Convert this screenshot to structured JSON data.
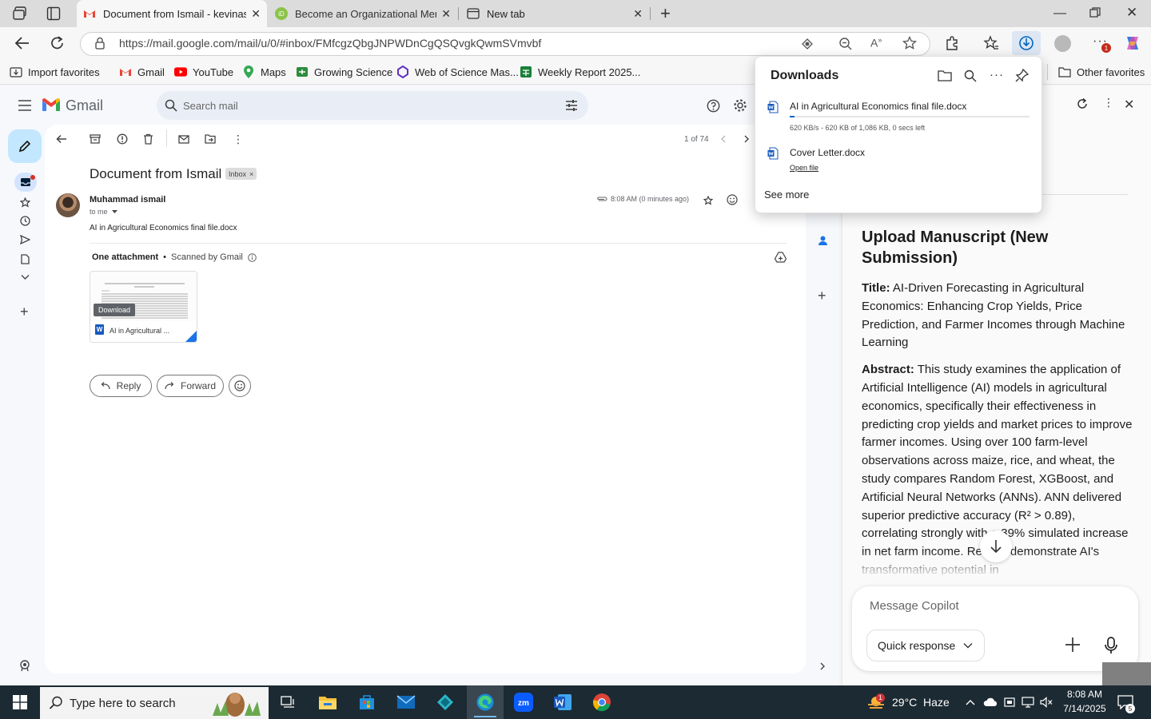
{
  "browser": {
    "tabs": [
      {
        "title": "Document from Ismail - kevinasut",
        "active": true
      },
      {
        "title": "Become an Organizational Memb",
        "active": false
      },
      {
        "title": "New tab",
        "active": false
      }
    ],
    "url": "https://mail.google.com/mail/u/0/#inbox/FMfcgzQbgJNPWDnCgQSQvgkQwmSVmvbf",
    "favorites": [
      "Import favorites",
      "Gmail",
      "YouTube",
      "Maps",
      "Growing Science",
      "Web of Science Mas...",
      "Weekly Report 2025..."
    ],
    "other_favorites": "Other favorites",
    "download_badge": "1"
  },
  "gmail": {
    "brand": "Gmail",
    "search_placeholder": "Search mail",
    "pager": "1 of 74",
    "subject": "Document from Ismail",
    "label": "Inbox",
    "label_close": "×",
    "sender": "Muhammad ismail",
    "to": "to me",
    "time": "8:08 AM (0 minutes ago)",
    "body": "AI in Agricultural Economics final file.docx",
    "attachment_header": "One attachment",
    "scanned": "Scanned by Gmail",
    "attachment_name": "AI in Agricultural ...",
    "download_label": "Download",
    "reply": "Reply",
    "forward": "Forward"
  },
  "downloads": {
    "title": "Downloads",
    "items": [
      {
        "name": "AI in Agricultural Economics final file.docx",
        "status": "620 KB/s - 620 KB of 1,086 KB, 0 secs left",
        "progress": 0.02
      },
      {
        "name": "Cover Letter.docx",
        "action": "Open file"
      }
    ],
    "see_more": "See more"
  },
  "copilot": {
    "heading": "Upload Manuscript (New Submission)",
    "title_label": "Title:",
    "title_text": "AI-Driven Forecasting in Agricultural Economics: Enhancing Crop Yields, Price Prediction, and Farmer Incomes through Machine Learning",
    "abstract_label": "Abstract:",
    "abstract_text": "This study examines the application of Artificial Intelligence (AI) models in agricultural economics, specifically their effectiveness in predicting crop yields and market prices to improve farmer incomes. Using over 100 farm-level observations across maize, rice, and wheat, the study compares Random Forest, XGBoost, and Artificial Neural Networks (ANNs). ANN delivered superior predictive accuracy (R² > 0.89), correlating strongly with a 39% simulated increase in net farm income. Results demonstrate AI's transformative potential in",
    "message_placeholder": "Message Copilot",
    "quick_response": "Quick response"
  },
  "taskbar": {
    "search_placeholder": "Type here to search",
    "weather_badge": "1",
    "weather": "29°C  Haze",
    "time": "8:08 AM",
    "date": "7/14/2025",
    "notifications": "5"
  },
  "colors": {
    "gmail_red": "#ea4335",
    "blue": "#0b57d0",
    "edge_blue": "#0067c0",
    "taskbar": "#1c2a33"
  }
}
